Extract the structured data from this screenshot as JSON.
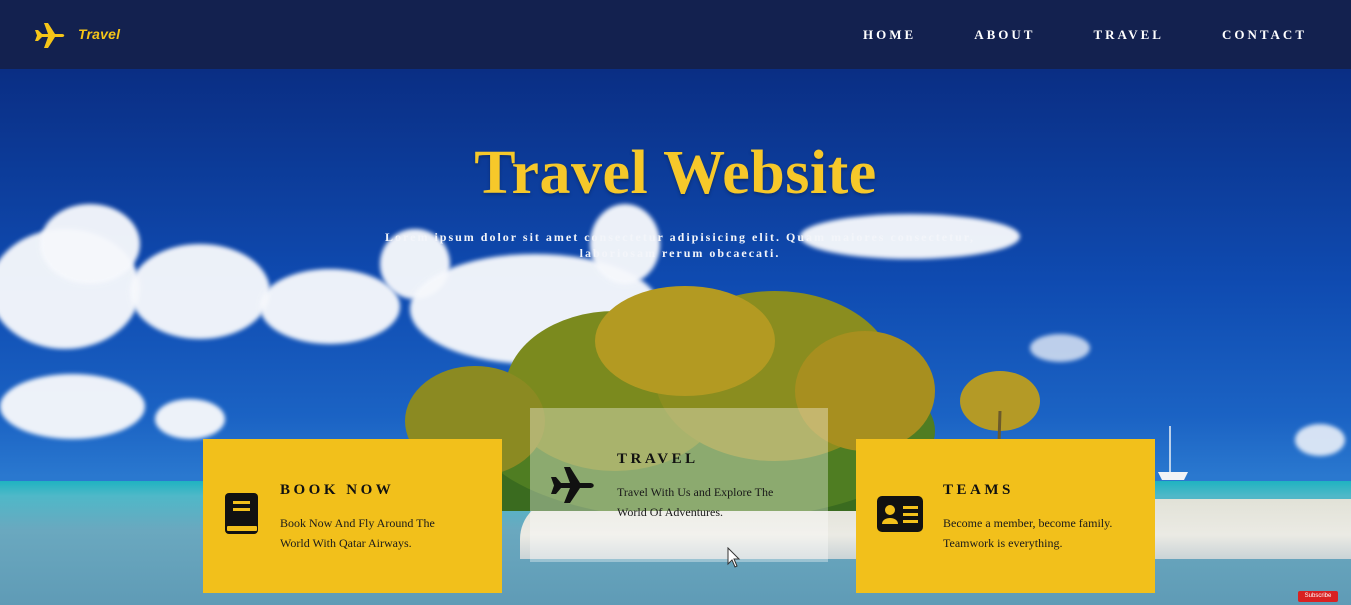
{
  "brand": {
    "name": "Travel",
    "icon": "airplane-icon",
    "color": "#f5c518"
  },
  "nav": {
    "items": [
      {
        "label": "HOME"
      },
      {
        "label": "ABOUT"
      },
      {
        "label": "TRAVEL"
      },
      {
        "label": "CONTACT"
      }
    ]
  },
  "hero": {
    "title": "Travel Website",
    "subtitle_line1": "Lorem ipsum dolor sit amet consectetur adipisicing elit. Quam maiores consectetur,",
    "subtitle_line2": "laboriosam rerum obcaecati."
  },
  "cards": [
    {
      "title": "BOOK NOW",
      "text_line1": "Book Now And Fly Around The",
      "text_line2": "World With Qatar Airways.",
      "icon": "book-icon",
      "color": "#f2c01b"
    },
    {
      "title": "TRAVEL",
      "text_line1": "Travel With Us and Explore The",
      "text_line2": "World Of Adventures.",
      "icon": "airplane-icon"
    },
    {
      "title": "TEAMS",
      "text_line1": "Become a member, become family.",
      "text_line2": "Teamwork is everything.",
      "icon": "id-card-icon",
      "color": "#f2c01b"
    }
  ],
  "youtube_badge": {
    "label": "Subscribe"
  },
  "colors": {
    "navbar": "#13214f",
    "accent": "#f6c82a"
  }
}
